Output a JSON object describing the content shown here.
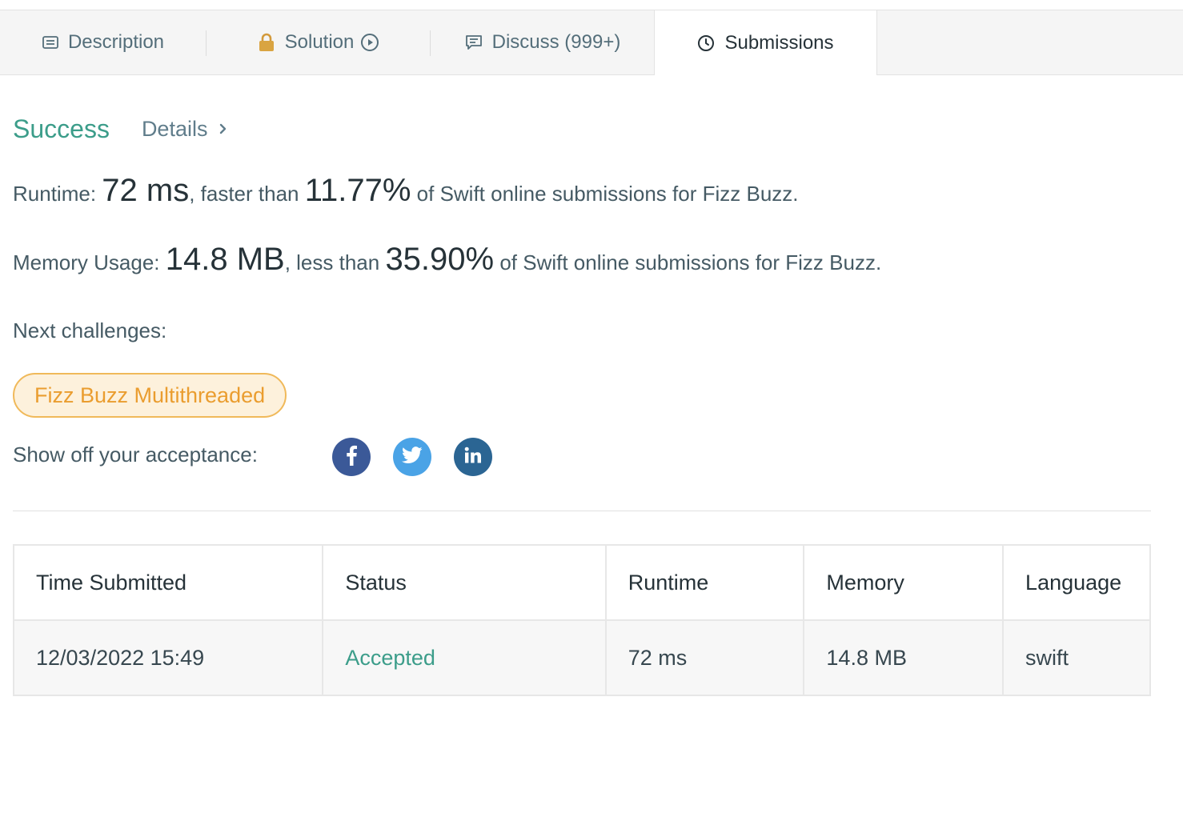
{
  "tabs": [
    {
      "label": "Description",
      "icon": "description-icon"
    },
    {
      "label": "Solution",
      "icon": "lock-icon",
      "trailing_icon": "play-circle-icon"
    },
    {
      "label": "Discuss (999+)",
      "icon": "comment-icon"
    },
    {
      "label": "Submissions",
      "icon": "clock-icon",
      "active": true
    }
  ],
  "result": {
    "status": "Success",
    "details_label": "Details",
    "runtime": {
      "label": "Runtime: ",
      "value": "72 ms",
      "comparison": ", faster than ",
      "percent": "11.77%",
      "suffix": " of Swift online submissions for Fizz Buzz."
    },
    "memory": {
      "label": "Memory Usage: ",
      "value": "14.8 MB",
      "comparison": ", less than ",
      "percent": "35.90%",
      "suffix": " of Swift online submissions for Fizz Buzz."
    },
    "next_label": "Next challenges:",
    "next_challenge": "Fizz Buzz Multithreaded",
    "share_label": "Show off your acceptance:"
  },
  "social": [
    {
      "name": "facebook",
      "color": "#3b5998"
    },
    {
      "name": "twitter",
      "color": "#4aa3e6"
    },
    {
      "name": "linkedin",
      "color": "#2b6593"
    }
  ],
  "table": {
    "headers": [
      "Time Submitted",
      "Status",
      "Runtime",
      "Memory",
      "Language"
    ],
    "rows": [
      [
        "12/03/2022 15:49",
        "Accepted",
        "72 ms",
        "14.8 MB",
        "swift"
      ]
    ]
  },
  "colors": {
    "success": "#3c9d8a",
    "challenge_text": "#ea9d2f",
    "challenge_border": "#f0b95a",
    "challenge_bg": "#fdf1dc"
  }
}
